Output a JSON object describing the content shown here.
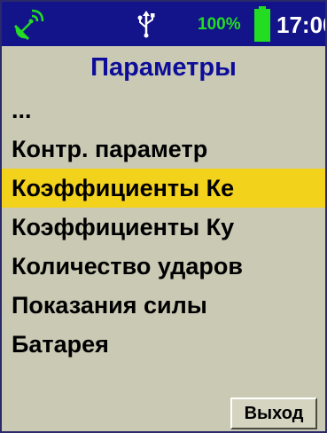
{
  "status_bar": {
    "icons": [
      "satellite-icon",
      "usb-icon",
      "battery-icon"
    ],
    "battery_percent": "100%",
    "battery_level": 1.0,
    "time": "17:00"
  },
  "header": {
    "title": "Параметры"
  },
  "menu": {
    "items": [
      {
        "label": "..."
      },
      {
        "label": "Контр. параметр"
      },
      {
        "label": "Коэффициенты Ке"
      },
      {
        "label": "Коэффициенты Ку"
      },
      {
        "label": "Количество ударов"
      },
      {
        "label": "Показания силы"
      },
      {
        "label": "Батарея"
      }
    ],
    "selected_label": "Коэффициенты Ке"
  },
  "footer": {
    "exit_label": "Выход"
  },
  "colors": {
    "status_bar_bg": "#14148a",
    "screen_bg": "#c9c9b4",
    "title_text": "#0d0d9a",
    "selection_bg": "#f3d21c",
    "battery_green": "#22dd22"
  }
}
